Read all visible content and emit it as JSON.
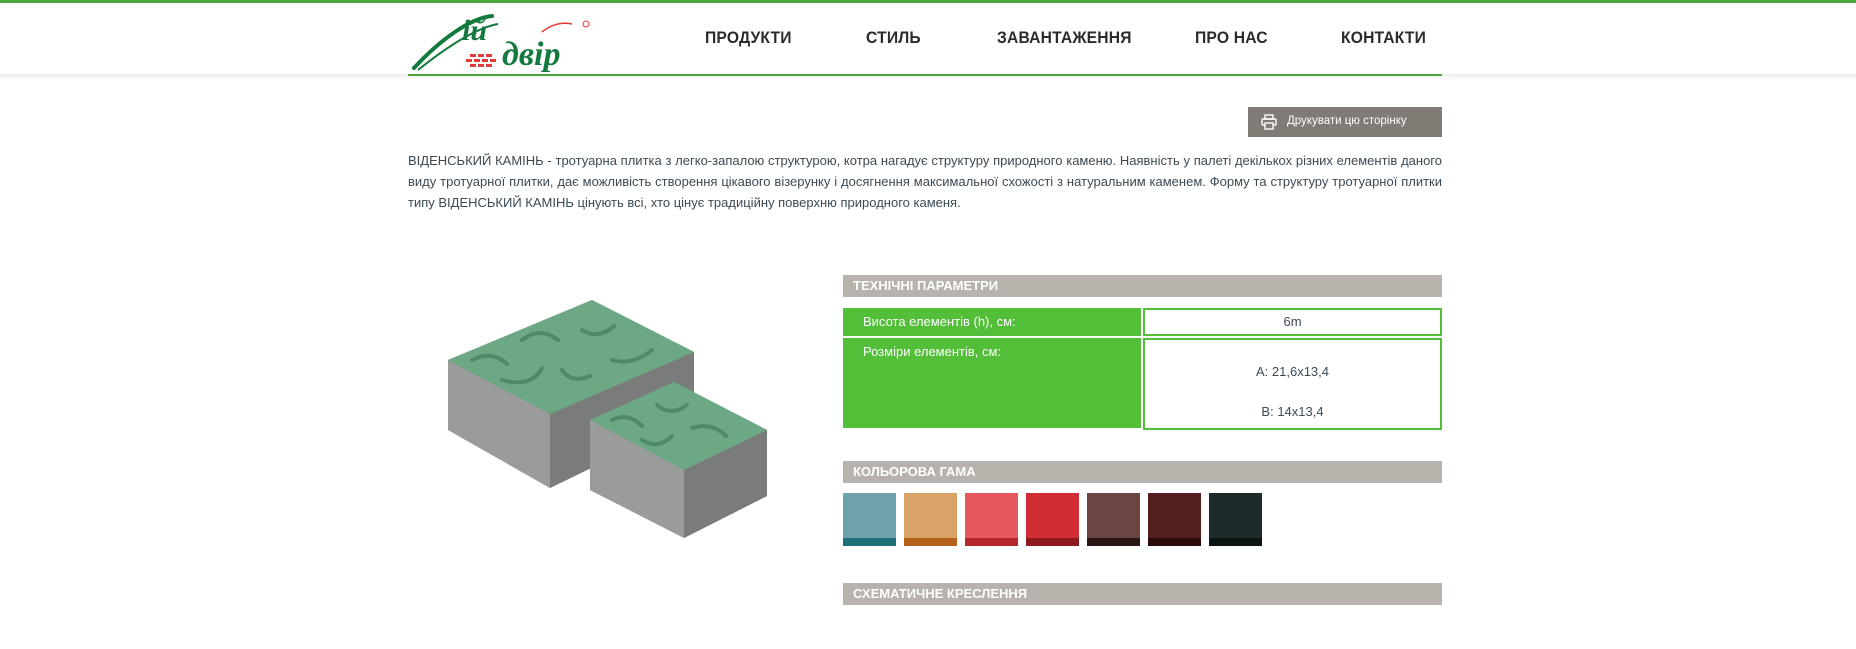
{
  "header": {
    "logo_text": "Мій Двір",
    "nav": [
      "ПРОДУКТИ",
      "СТИЛЬ",
      "ЗАВАНТАЖЕННЯ",
      "ПРО НАС",
      "КОНТАКТИ"
    ]
  },
  "print_button": {
    "label": "Друкувати цю сторінку",
    "icon": "printer-icon"
  },
  "description": "ВІДЕНСЬКИЙ КАМІНЬ - тротуарна плитка з легко-запалою структурою, котра нагадує структуру природного каменю. Наявність у палеті декількох різних елементів даного  виду тротуарної плитки, дає можливість створення цікавого візерунку і досягнення максимальної схожості з натуральним каменем. Форму та структуру тротуарної плитки типу ВІДЕНСЬКИЙ КАМІНЬ цінують всі, хто цінує традиційну поверхню природного каменя.",
  "tech": {
    "title": "ТЕХНІЧНІ ПАРАМЕТРИ",
    "rows": [
      {
        "label": "Висота елементів (h), см:",
        "values": [
          "6m"
        ]
      },
      {
        "label": "Розміри елементів, см:",
        "values": [
          "А: 21,6x13,4",
          "В: 14x13,4"
        ]
      }
    ]
  },
  "colors": {
    "title": "КОЛЬОРОВА ГАМА",
    "swatches": [
      "#6fa3ab",
      "#d9a267",
      "#e6575c",
      "#d12d35",
      "#6a4541",
      "#53201f",
      "#1e2b2c"
    ],
    "shades": [
      "#1f6f78",
      "#b5621a",
      "#b8262b",
      "#8e1a1f",
      "#2a1714",
      "#2a0c0b",
      "#0d1414"
    ]
  },
  "scheme": {
    "title": "СХЕМАТИЧНЕ КРЕСЛЕННЯ"
  },
  "accent": "#53be37",
  "bar_color": "#b8b2ac",
  "product_color": "#6ba883"
}
